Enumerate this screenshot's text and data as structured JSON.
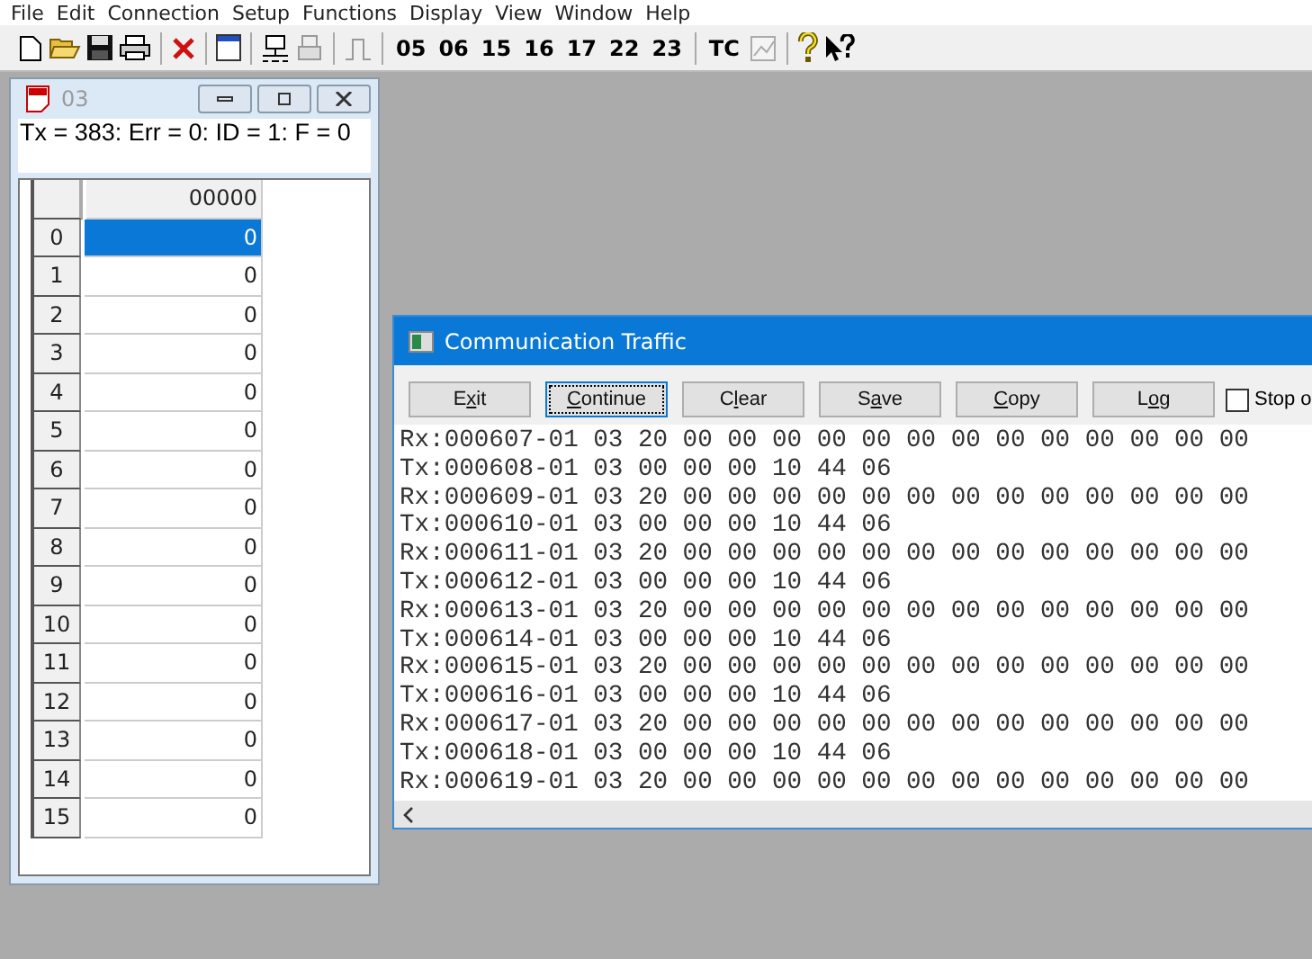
{
  "menu": [
    "File",
    "Edit",
    "Connection",
    "Setup",
    "Functions",
    "Display",
    "View",
    "Window",
    "Help"
  ],
  "toolbar": {
    "function_codes": [
      "05",
      "06",
      "15",
      "16",
      "17",
      "22",
      "23"
    ],
    "tc": "TC"
  },
  "data_window": {
    "title": "03",
    "active": false,
    "status": "Tx = 383: Err = 0: ID = 1: F = 0",
    "table": {
      "column": "00000",
      "rows": [
        {
          "index": "0",
          "value": "0",
          "selected": true
        },
        {
          "index": "1",
          "value": "0",
          "selected": false
        },
        {
          "index": "2",
          "value": "0",
          "selected": false
        },
        {
          "index": "3",
          "value": "0",
          "selected": false
        },
        {
          "index": "4",
          "value": "0",
          "selected": false
        },
        {
          "index": "5",
          "value": "0",
          "selected": false
        },
        {
          "index": "6",
          "value": "0",
          "selected": false
        },
        {
          "index": "7",
          "value": "0",
          "selected": false
        },
        {
          "index": "8",
          "value": "0",
          "selected": false
        },
        {
          "index": "9",
          "value": "0",
          "selected": false
        },
        {
          "index": "10",
          "value": "0",
          "selected": false
        },
        {
          "index": "11",
          "value": "0",
          "selected": false
        },
        {
          "index": "12",
          "value": "0",
          "selected": false
        },
        {
          "index": "13",
          "value": "0",
          "selected": false
        },
        {
          "index": "14",
          "value": "0",
          "selected": false
        },
        {
          "index": "15",
          "value": "0",
          "selected": false
        }
      ]
    }
  },
  "traffic_window": {
    "title": "Communication Traffic",
    "active": true,
    "buttons": [
      {
        "before": "E",
        "key": "x",
        "after": "it",
        "focused": false
      },
      {
        "key": "C",
        "after": "ontinue",
        "focused": true
      },
      {
        "before": "C",
        "key": "l",
        "after": "ear",
        "focused": false
      },
      {
        "before": "S",
        "key": "a",
        "after": "ve",
        "focused": false
      },
      {
        "key": "C",
        "after": "opy",
        "focused": false
      },
      {
        "before": "L",
        "key": "o",
        "after": "g",
        "focused": false
      }
    ],
    "checkbox": {
      "label": "Stop o",
      "checked": false
    },
    "lines": [
      "Rx:000607-01 03 20 00 00 00 00 00 00 00 00 00 00 00 00 00",
      "Tx:000608-01 03 00 00 00 10 44 06",
      "Rx:000609-01 03 20 00 00 00 00 00 00 00 00 00 00 00 00 00",
      "Tx:000610-01 03 00 00 00 10 44 06",
      "Rx:000611-01 03 20 00 00 00 00 00 00 00 00 00 00 00 00 00",
      "Tx:000612-01 03 00 00 00 10 44 06",
      "Rx:000613-01 03 20 00 00 00 00 00 00 00 00 00 00 00 00 00",
      "Tx:000614-01 03 00 00 00 10 44 06",
      "Rx:000615-01 03 20 00 00 00 00 00 00 00 00 00 00 00 00 00",
      "Tx:000616-01 03 00 00 00 10 44 06",
      "Rx:000617-01 03 20 00 00 00 00 00 00 00 00 00 00 00 00 00",
      "Tx:000618-01 03 00 00 00 10 44 06",
      "Rx:000619-01 03 20 00 00 00 00 00 00 00 00 00 00 00 00 00"
    ]
  }
}
